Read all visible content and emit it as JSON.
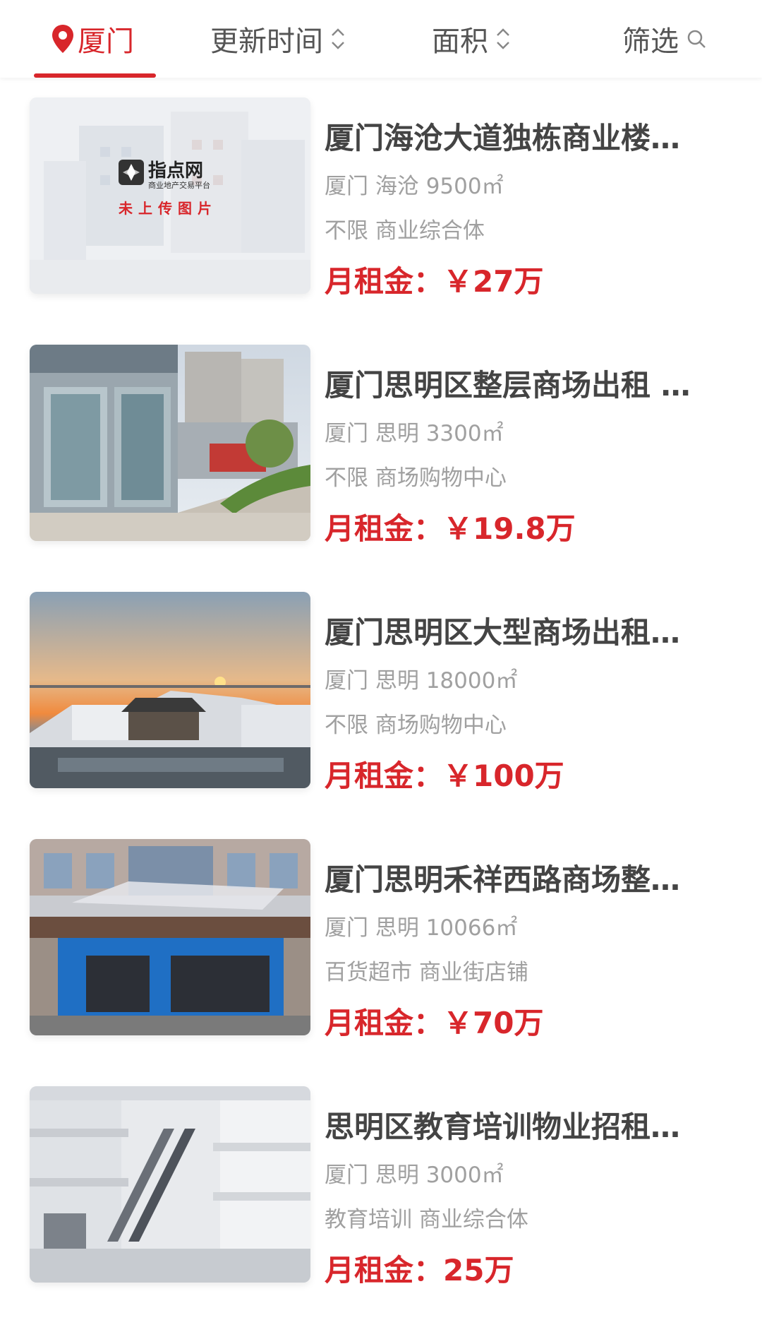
{
  "header": {
    "city": "厦门",
    "sort_time": "更新时间",
    "sort_area": "面积",
    "filter": "筛选",
    "accent_color": "#d8262b"
  },
  "listings": [
    {
      "title": "厦门海沧大道独栋商业楼…",
      "location": "厦门 海沧 9500㎡",
      "tags": "不限 商业综合体",
      "price": "月租金：￥27万",
      "image": "no-image-placeholder",
      "placeholder_brand": "指点网",
      "placeholder_sub": "商业地产交易平台",
      "placeholder_note": "未上传图片"
    },
    {
      "title": "厦门思明区整层商场出租 …",
      "location": "厦门 思明 3300㎡",
      "tags": "不限 商场购物中心",
      "price": "月租金：￥19.8万",
      "image": "mall-plaza-photo"
    },
    {
      "title": "厦门思明区大型商场出租…",
      "location": "厦门 思明 18000㎡",
      "tags": "不限 商场购物中心",
      "price": "月租金：￥100万",
      "image": "sunset-seaside-photo"
    },
    {
      "title": "厦门思明禾祥西路商场整…",
      "location": "厦门 思明 10066㎡",
      "tags": "百货超市 商业街店铺",
      "price": "月租金：￥70万",
      "image": "walmart-storefront-photo"
    },
    {
      "title": "思明区教育培训物业招租…",
      "location": "厦门 思明 3000㎡",
      "tags": "教育培训 商业综合体",
      "price": "月租金：25万",
      "image": "atrium-escalator-photo"
    }
  ]
}
